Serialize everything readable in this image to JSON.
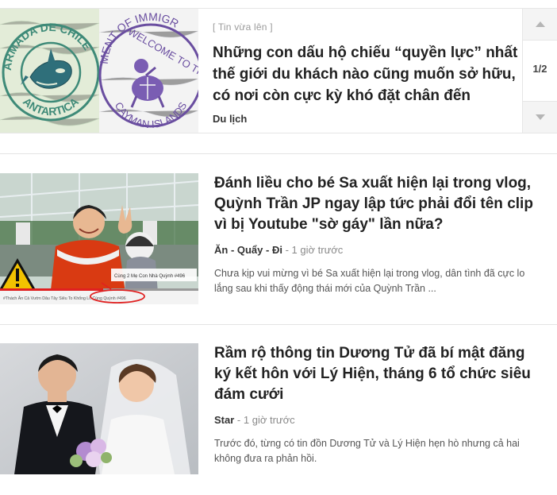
{
  "featured": {
    "tag": "[ Tin vừa lên ]",
    "title": "Những con dấu hộ chiếu “quyền lực” nhất thế giới du khách nào cũng muốn sở hữu, có nơi còn cực kỳ khó đặt chân đến",
    "category": "Du lịch",
    "pager": "1/2",
    "stamps": {
      "left_top": "ARMADA DE CHILE",
      "left_bottom": "ANTARTICA",
      "right_top": "MENT OF IMMIGR",
      "right_mid": "WELCOME TO THE",
      "right_bottom": "CAYMAN ISLANDS"
    }
  },
  "articles": [
    {
      "title": "Đánh liều cho bé Sa xuất hiện lại trong vlog, Quỳnh Trần JP ngay lập tức phải đổi tên clip vì bị Youtube \"sờ gáy\" lần nữa?",
      "category": "Ăn - Quẩy - Đi",
      "separator": "-",
      "time": "1 giờ trước",
      "summary": "Chưa kịp vui mừng vì bé Sa xuất hiện lại trong vlog, dân tình đã cực lo lắng sau khi thấy động thái mới của Quỳnh Trần ...",
      "thumb_caption": "Cùng 2 Mẹ Con Nhà Quỳnh #496",
      "thumb_bottom_text": "#Thách Ăn Cả Vườn Dâu Tây Siêu To Khổng Lồ Cùng Quỳnh #496"
    },
    {
      "title": "Rầm rộ thông tin Dương Tử đã bí mật đăng ký kết hôn với Lý Hiện, tháng 6 tổ chức siêu đám cưới",
      "category": "Star",
      "separator": "-",
      "time": "1 giờ trước",
      "summary": "Trước đó, từng có tin đồn Dương Tử và Lý Hiện hẹn hò nhưng cả hai không đưa ra phản hồi."
    }
  ],
  "colors": {
    "stamp_green": "#3e8a78",
    "stamp_purple": "#6a4ea0",
    "warning_yellow": "#f2c200",
    "jacket_red": "#d93a12"
  }
}
